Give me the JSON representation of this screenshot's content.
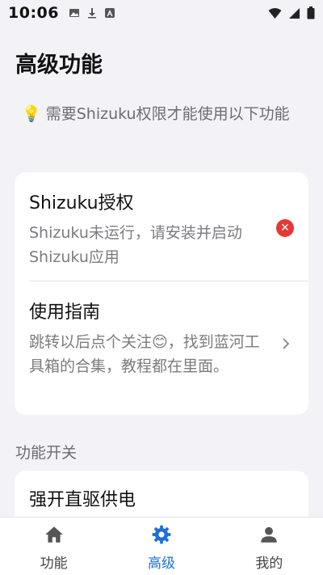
{
  "status_bar": {
    "time": "10:06",
    "icons_left": [
      "image-icon",
      "download-icon",
      "app-a-icon"
    ],
    "icons_right": [
      "wifi-icon",
      "cellular-icon",
      "battery-icon"
    ]
  },
  "page": {
    "title": "高级功能",
    "hint_icon": "💡",
    "hint_text": " 需要Shizuku权限才能使用以下功能"
  },
  "card_main": {
    "auth": {
      "title": "Shizuku授权",
      "desc": "Shizuku未运行，请安装并启动Shizuku应用",
      "status_icon": "error-icon"
    },
    "guide": {
      "title": "使用指南",
      "desc": "跳转以后点个关注😊，找到蓝河工具箱的合集，教程都在里面。",
      "action_icon": "chevron-right-icon"
    }
  },
  "section": {
    "label": "功能开关"
  },
  "card_switches": {
    "first": {
      "title": "强开直驱供电"
    }
  },
  "bottom_nav": {
    "items": [
      {
        "label": "功能",
        "icon": "home-icon",
        "active": false
      },
      {
        "label": "高级",
        "icon": "gear-icon",
        "active": true
      },
      {
        "label": "我的",
        "icon": "person-icon",
        "active": false
      }
    ]
  },
  "colors": {
    "accent": "#1e6fd9",
    "background": "#f2f2f7",
    "error": "#e53935"
  }
}
